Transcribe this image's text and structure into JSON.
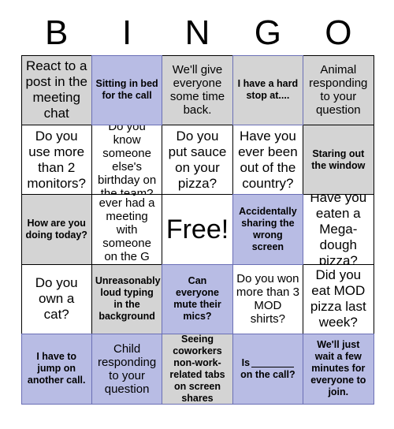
{
  "header": {
    "letters": [
      "B",
      "I",
      "N",
      "G",
      "O"
    ]
  },
  "colors": {
    "marked_fill": "#b8bce4",
    "marked_border": "#6a6fb5",
    "gray_fill": "#d4d4d4",
    "plain_fill": "#ffffff",
    "plain_border": "#000000",
    "text": "#000000"
  },
  "grid": {
    "columns": 5,
    "rows": 5,
    "cells": [
      {
        "text": "React to a post in the meeting chat",
        "state": "gray",
        "size": "lg"
      },
      {
        "text": "Sitting in bed for the call",
        "state": "marked",
        "size": "sm"
      },
      {
        "text": "We'll give everyone some time back.",
        "state": "gray",
        "size": "md"
      },
      {
        "text": "I have a hard stop at....",
        "state": "gray-blueborder",
        "size": "sm"
      },
      {
        "text": "Animal responding to your question",
        "state": "gray",
        "size": "md"
      },
      {
        "text": "Do you use more than 2 monitors?",
        "state": "plain",
        "size": "lg"
      },
      {
        "text": "Do you know someone else's birthday on the team?",
        "state": "plain",
        "size": "md"
      },
      {
        "text": "Do you put sauce on your pizza?",
        "state": "plain",
        "size": "lg"
      },
      {
        "text": "Have you ever been out of the country?",
        "state": "plain",
        "size": "lg"
      },
      {
        "text": "Staring out the window",
        "state": "gray",
        "size": "sm"
      },
      {
        "text": "How are you doing today?",
        "state": "gray",
        "size": "sm"
      },
      {
        "text": "Have you ever had a meeting with someone on the G Team?",
        "state": "plain",
        "size": "md"
      },
      {
        "text": "Free!",
        "state": "plain",
        "size": "free"
      },
      {
        "text": "Accidentally sharing the wrong screen",
        "state": "marked",
        "size": "sm"
      },
      {
        "text": "Have you eaten a Mega-dough pizza?",
        "state": "plain",
        "size": "lg"
      },
      {
        "text": "Do you own a cat?",
        "state": "plain",
        "size": "lg"
      },
      {
        "text": "Unreasonably loud typing in the background",
        "state": "gray",
        "size": "sm"
      },
      {
        "text": "Can everyone mute their mics?",
        "state": "marked",
        "size": "sm"
      },
      {
        "text": "Do you won more than 3 MOD shirts?",
        "state": "plain",
        "size": "md"
      },
      {
        "text": "Did you eat MOD pizza last week?",
        "state": "plain",
        "size": "lg"
      },
      {
        "text": "I have to jump on another call.",
        "state": "marked",
        "size": "sm"
      },
      {
        "text": "Child responding to your question",
        "state": "marked",
        "size": "md"
      },
      {
        "text": "Seeing coworkers non-work-related tabs on screen shares",
        "state": "gray-blueborder",
        "size": "sm"
      },
      {
        "text": "Is ____ on the call?",
        "state": "marked",
        "size": "sm",
        "has_blank": true,
        "blank_prefix": "Is",
        "blank_suffix": "on the call?"
      },
      {
        "text": "We'll just wait a few minutes for everyone to join.",
        "state": "marked",
        "size": "sm"
      }
    ]
  }
}
